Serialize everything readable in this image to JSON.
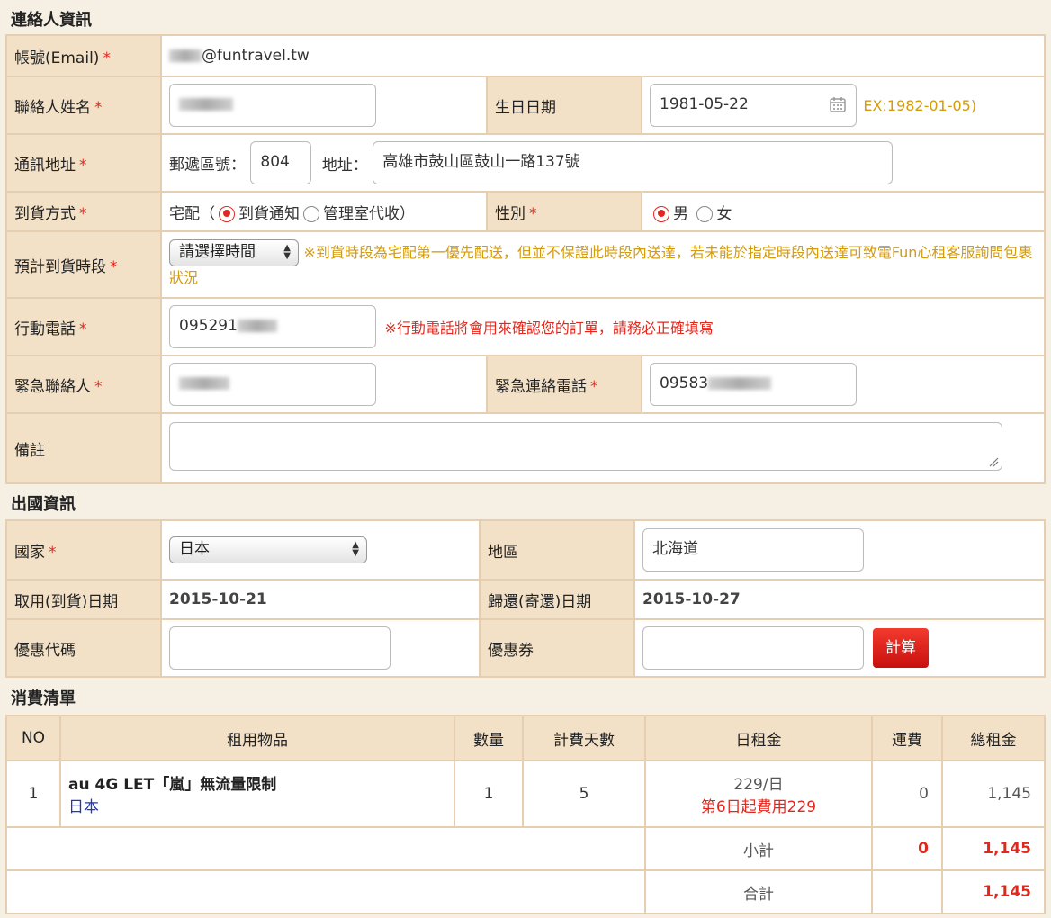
{
  "contact": {
    "section_title": "連絡人資訊",
    "email_label": "帳號(Email)",
    "email_suffix": "@funtravel.tw",
    "name_label": "聯絡人姓名",
    "birthday_label": "生日日期",
    "birthday_value": "1981-05-22",
    "birthday_hint": "EX:1982-01-05)",
    "address_label": "通訊地址",
    "zip_label": "郵遞區號：",
    "zip_value": "804",
    "addr_label": "地址：",
    "addr_value": "高雄市鼓山區鼓山一路137號",
    "delivery_label": "到貨方式",
    "delivery_prefix": "宅配（",
    "delivery_opt1": "到貨通知",
    "delivery_opt2": "管理室代收）",
    "gender_label": "性別",
    "gender_male": "男",
    "gender_female": "女",
    "timeslot_label": "預計到貨時段",
    "timeslot_select": "請選擇時間",
    "timeslot_note": "※到貨時段為宅配第一優先配送，但並不保證此時段內送達，若未能於指定時段內送達可致電Fun心租客服詢問包裹狀況",
    "mobile_label": "行動電話",
    "mobile_value": "095291",
    "mobile_note": "※行動電話將會用來確認您的訂單，請務必正確填寫",
    "emergency_label": "緊急聯絡人",
    "emergency_phone_label": "緊急連絡電話",
    "emergency_phone_value": "09583",
    "remark_label": "備註",
    "required_mark": "*"
  },
  "travel": {
    "section_title": "出國資訊",
    "country_label": "國家",
    "country_value": "日本",
    "region_label": "地區",
    "region_value": "北海道",
    "pickup_label": "取用(到貨)日期",
    "pickup_value": "2015-10-21",
    "return_label": "歸還(寄還)日期",
    "return_value": "2015-10-27",
    "promo_label": "優惠代碼",
    "coupon_label": "優惠券",
    "calc_button": "計算"
  },
  "order": {
    "section_title": "消費清單",
    "headers": [
      "NO",
      "租用物品",
      "數量",
      "計費天數",
      "日租金",
      "運費",
      "總租金"
    ],
    "row": {
      "no": "1",
      "item": "au 4G LET「嵐」無流量限制",
      "item_country": "日本",
      "qty": "1",
      "days": "5",
      "daily": "229/日",
      "daily_note": "第6日起費用229",
      "shipping": "0",
      "total": "1,145"
    },
    "subtotal_label": "小計",
    "subtotal_shipping": "0",
    "subtotal_total": "1,145",
    "grand_label": "合計",
    "grand_total": "1,145"
  },
  "colors": {
    "label_bg": "#f2e1c7",
    "border": "#e6cfb0",
    "accent_red": "#e0281e",
    "hint_gold": "#d39b0d"
  }
}
